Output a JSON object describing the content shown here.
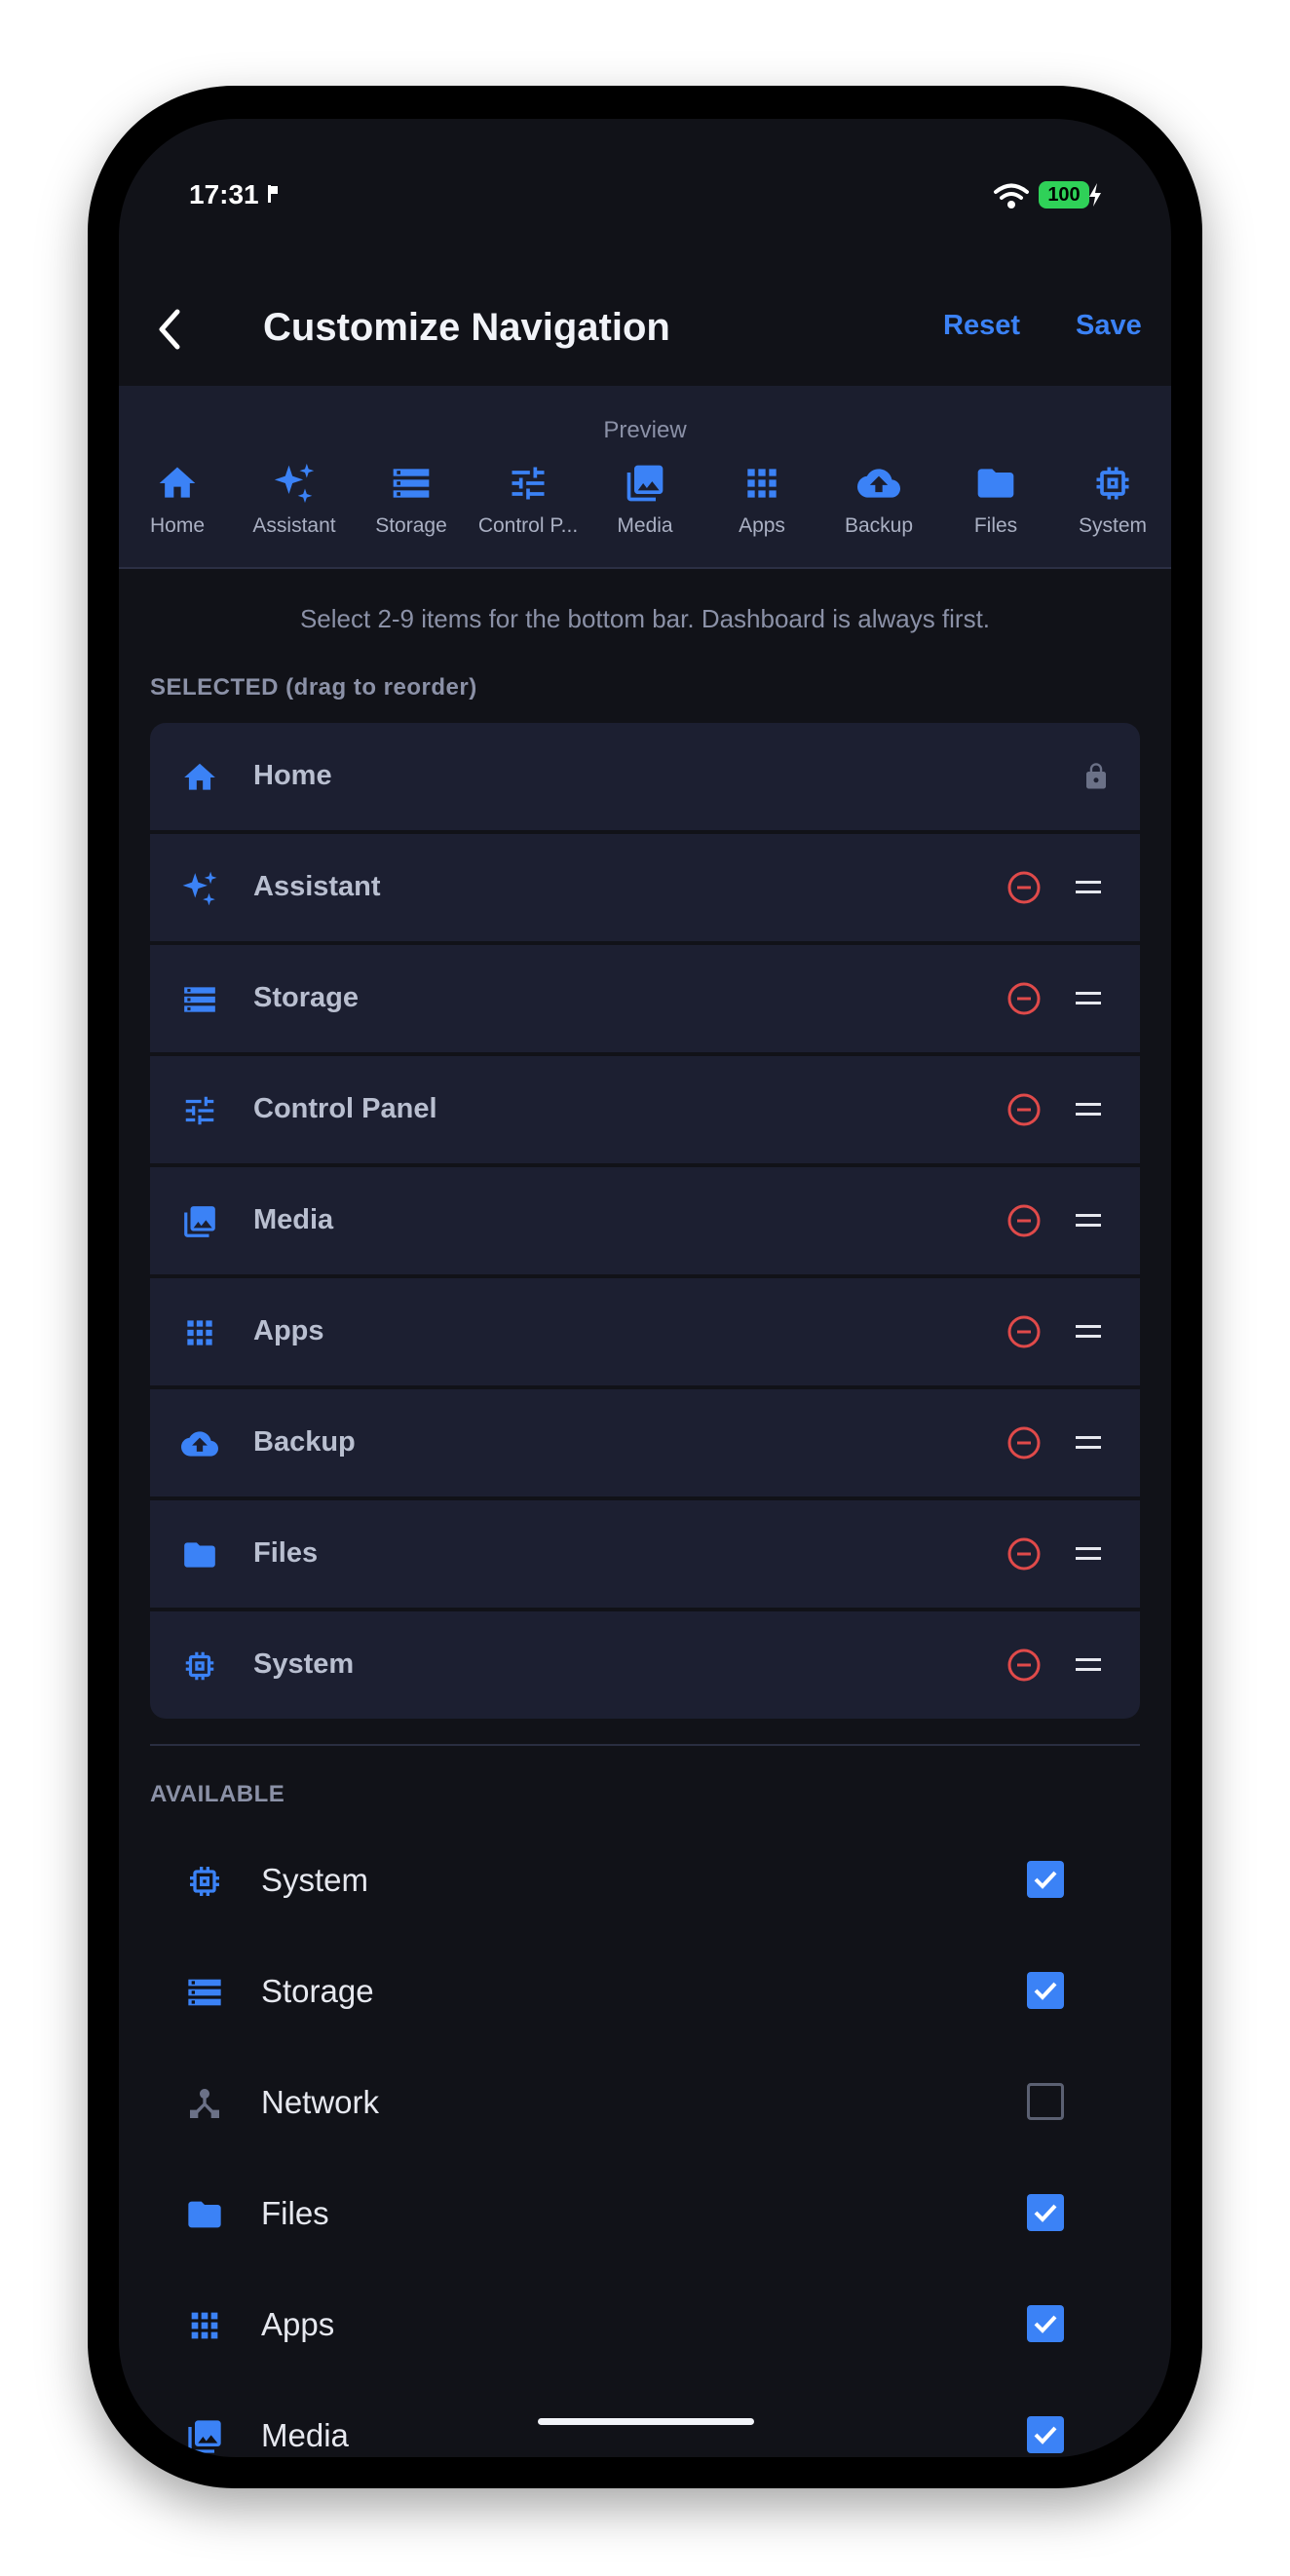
{
  "status_bar": {
    "time": "17:31",
    "battery": "100"
  },
  "header": {
    "title": "Customize Navigation",
    "reset_label": "Reset",
    "save_label": "Save"
  },
  "preview": {
    "label": "Preview",
    "items": [
      {
        "label": "Home",
        "icon": "home-icon"
      },
      {
        "label": "Assistant",
        "icon": "sparkle-icon"
      },
      {
        "label": "Storage",
        "icon": "storage-icon"
      },
      {
        "label": "Control P...",
        "icon": "sliders-icon"
      },
      {
        "label": "Media",
        "icon": "photo-library-icon"
      },
      {
        "label": "Apps",
        "icon": "apps-grid-icon"
      },
      {
        "label": "Backup",
        "icon": "cloud-upload-icon"
      },
      {
        "label": "Files",
        "icon": "folder-icon"
      },
      {
        "label": "System",
        "icon": "chip-icon"
      }
    ]
  },
  "hint": "Select 2-9 items for the bottom bar. Dashboard is always first.",
  "selected": {
    "heading": "SELECTED (drag to reorder)",
    "items": [
      {
        "label": "Home",
        "icon": "home-icon",
        "locked": true
      },
      {
        "label": "Assistant",
        "icon": "sparkle-icon"
      },
      {
        "label": "Storage",
        "icon": "storage-icon"
      },
      {
        "label": "Control Panel",
        "icon": "sliders-icon"
      },
      {
        "label": "Media",
        "icon": "photo-library-icon"
      },
      {
        "label": "Apps",
        "icon": "apps-grid-icon"
      },
      {
        "label": "Backup",
        "icon": "cloud-upload-icon"
      },
      {
        "label": "Files",
        "icon": "folder-icon"
      },
      {
        "label": "System",
        "icon": "chip-icon"
      }
    ]
  },
  "available": {
    "heading": "AVAILABLE",
    "items": [
      {
        "label": "System",
        "icon": "chip-icon",
        "checked": true
      },
      {
        "label": "Storage",
        "icon": "storage-icon",
        "checked": true
      },
      {
        "label": "Network",
        "icon": "network-icon",
        "checked": false
      },
      {
        "label": "Files",
        "icon": "folder-icon",
        "checked": true
      },
      {
        "label": "Apps",
        "icon": "apps-grid-icon",
        "checked": true
      },
      {
        "label": "Media",
        "icon": "photo-library-icon",
        "checked": true
      }
    ]
  },
  "colors": {
    "accent": "#3b82f6",
    "remove": "#e04a4a",
    "background": "#111218",
    "row": "#1c1f31"
  }
}
